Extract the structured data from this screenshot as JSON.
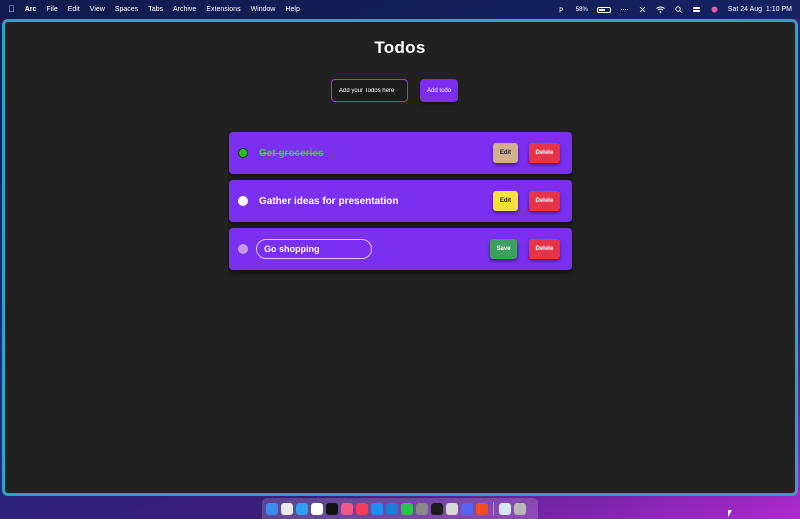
{
  "menubar": {
    "app_name": "Arc",
    "items": [
      "File",
      "Edit",
      "View",
      "Spaces",
      "Tabs",
      "Archive",
      "Extensions",
      "Window",
      "Help"
    ],
    "battery": "58%",
    "battery_level": 0.58,
    "datetime": "Sat 24 Aug  1:10 PM"
  },
  "app": {
    "title": "Todos",
    "input_placeholder": "Add your Todos here",
    "add_button": "Add todo",
    "todos": [
      {
        "text": "Get groceries",
        "completed": true,
        "editing": false,
        "edit_label": "Edit",
        "delete_label": "Delete",
        "edit_color": "#d2b08e"
      },
      {
        "text": "Gather ideas for presentation",
        "completed": false,
        "editing": false,
        "edit_label": "Edit",
        "delete_label": "Delete",
        "edit_color": "#f7e13c"
      },
      {
        "text": "Go shopping",
        "completed": false,
        "editing": true,
        "save_label": "Save",
        "delete_label": "Delete"
      }
    ]
  },
  "colors": {
    "accent": "#7b2ff0",
    "window_border": "#2aa6c4",
    "delete": "#e8344b",
    "save": "#3da05e",
    "completed_text": "#2ad92a"
  },
  "dock": {
    "icons": [
      {
        "name": "finder-icon",
        "color": "#3b8cf0"
      },
      {
        "name": "launchpad-icon",
        "color": "#e9e9e9"
      },
      {
        "name": "safari-icon",
        "color": "#2f9df0"
      },
      {
        "name": "notion-icon",
        "color": "#ffffff"
      },
      {
        "name": "apple-tv-icon",
        "color": "#111111"
      },
      {
        "name": "arc-icon",
        "color": "#f05a8a"
      },
      {
        "name": "music-icon",
        "color": "#f53d5a"
      },
      {
        "name": "app-store-icon",
        "color": "#1e8cf5"
      },
      {
        "name": "vscode-icon",
        "color": "#1f7bd6"
      },
      {
        "name": "whatsapp-icon",
        "color": "#2bc24a"
      },
      {
        "name": "settings-icon",
        "color": "#8a8a8a"
      },
      {
        "name": "terminal-icon",
        "color": "#1c1c1c"
      },
      {
        "name": "preview-icon",
        "color": "#d8d8d8"
      },
      {
        "name": "discord-icon",
        "color": "#5865f2"
      },
      {
        "name": "figma-icon",
        "color": "#f24e1e"
      },
      {
        "name": "downloads-icon",
        "color": "#d9e4f5"
      },
      {
        "name": "trash-icon",
        "color": "#b8b8b8"
      }
    ]
  }
}
